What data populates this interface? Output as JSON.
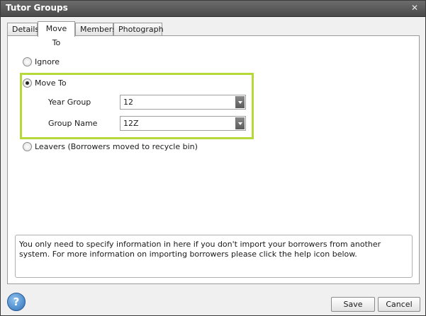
{
  "window": {
    "title": "Tutor Groups"
  },
  "tabs": [
    {
      "label": "Details"
    },
    {
      "label": "Move To"
    },
    {
      "label": "Members"
    },
    {
      "label": "Photograph"
    }
  ],
  "move_to": {
    "options": {
      "ignore": "Ignore",
      "move_to": "Move To",
      "leavers": "Leavers (Borrowers moved to recycle bin)"
    },
    "selected_option": "Move To",
    "year_group": {
      "label": "Year Group",
      "value": "12"
    },
    "group_name": {
      "label": "Group Name",
      "value": "12Z"
    }
  },
  "info_text": "You only need to specify information in here if you don't import your borrowers from another system. For more information on importing borrowers please click the help icon below.",
  "footer": {
    "help_glyph": "?",
    "save_label": "Save",
    "cancel_label": "Cancel"
  },
  "colors": {
    "highlight_border": "#b6d93a",
    "titlebar": "#4a4a4a"
  }
}
